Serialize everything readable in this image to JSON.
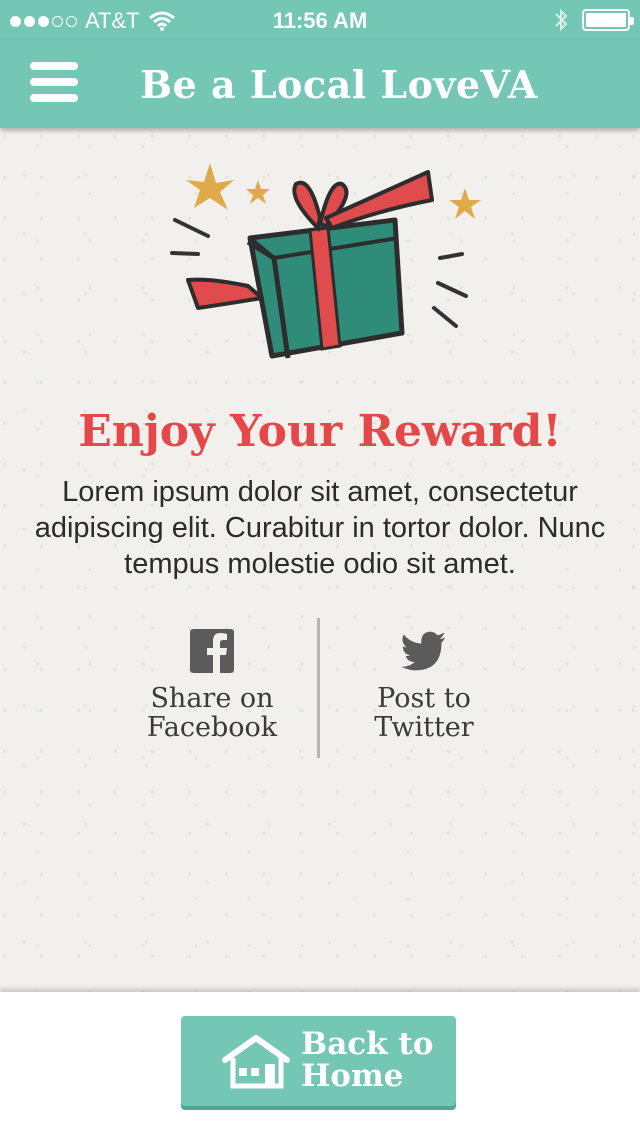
{
  "status_bar": {
    "carrier": "AT&T",
    "time": "11:56 AM"
  },
  "header": {
    "title": "Be a Local LoveVA",
    "menu_icon": "hamburger-menu-icon"
  },
  "main": {
    "illustration_icon": "gift-box-icon",
    "title": "Enjoy Your Reward!",
    "body": "Lorem ipsum dolor sit amet, consectetur adipiscing elit. Curabitur in tortor dolor. Nunc tempus molestie odio sit amet.",
    "share": {
      "facebook_label": "Share on\nFacebook",
      "facebook_icon": "facebook-icon",
      "twitter_label": "Post to\nTwitter",
      "twitter_icon": "twitter-bird-icon"
    }
  },
  "footer": {
    "home_label": "Back to\nHome",
    "home_icon": "house-icon"
  },
  "colors": {
    "accent": "#74c6b5",
    "accent_dark": "#4ea693",
    "title_red": "#e5484a",
    "gift_green": "#2f8c78",
    "ribbon_red": "#e04b4d",
    "star_gold": "#e0a94a"
  }
}
